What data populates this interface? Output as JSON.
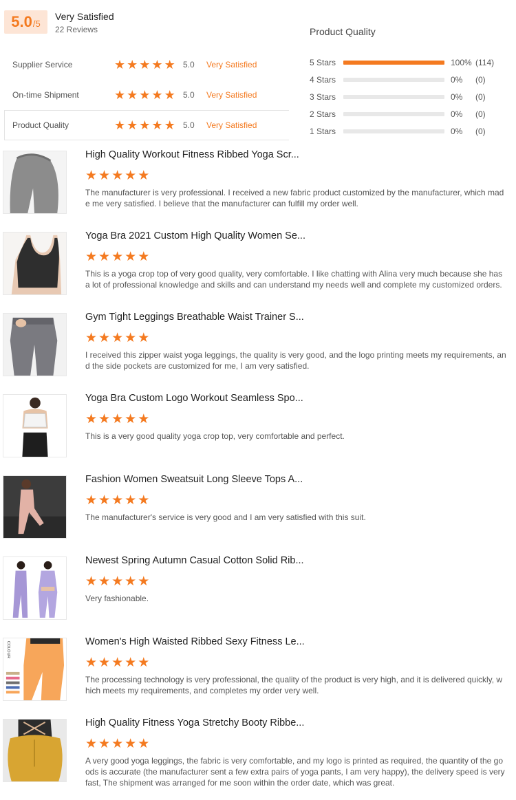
{
  "summary": {
    "score": "5.0",
    "score_max": "/5",
    "label": "Very Satisfied",
    "review_count": "22 Reviews",
    "star_glyph": "★",
    "accent_color": "#f47a20",
    "ratings": [
      {
        "label": "Supplier Service",
        "value": "5.0",
        "text": "Very Satisfied",
        "stars": 5
      },
      {
        "label": "On-time Shipment",
        "value": "5.0",
        "text": "Very Satisfied",
        "stars": 5
      },
      {
        "label": "Product Quality",
        "value": "5.0",
        "text": "Very Satisfied",
        "stars": 5
      }
    ]
  },
  "product_quality": {
    "title": "Product Quality",
    "rows": [
      {
        "label": "5 Stars",
        "percent": "100%",
        "count": "(114)",
        "fraction": 1.0
      },
      {
        "label": "4 Stars",
        "percent": "0%",
        "count": "(0)",
        "fraction": 0
      },
      {
        "label": "3 Stars",
        "percent": "0%",
        "count": "(0)",
        "fraction": 0
      },
      {
        "label": "2 Stars",
        "percent": "0%",
        "count": "(0)",
        "fraction": 0
      },
      {
        "label": "1 Stars",
        "percent": "0%",
        "count": "(0)",
        "fraction": 0
      }
    ]
  },
  "reviews": [
    {
      "title": "High Quality Workout Fitness Ribbed Yoga Scr...",
      "stars": 5,
      "text": "The manufacturer is very professional. I received a new fabric product customized by the manufacturer, which made me very satisfied. I believe that the manufacturer can fulfill my order well.",
      "thumb": "grey-leggings"
    },
    {
      "title": "Yoga Bra 2021 Custom High Quality Women Se...",
      "stars": 5,
      "text": "This is a yoga crop top of very good quality, very comfortable. I like chatting with Alina very much because she has a lot of professional knowledge and skills and can understand my needs well and complete my customized orders.",
      "thumb": "black-bra"
    },
    {
      "title": "Gym Tight Leggings Breathable Waist Trainer S...",
      "stars": 5,
      "text": "I received this zipper waist yoga leggings, the quality is very good, and the logo printing meets my requirements, and the side pockets are customized for me, I am very satisfied.",
      "thumb": "grey-waist-leggings"
    },
    {
      "title": "Yoga Bra Custom Logo Workout Seamless Spo...",
      "stars": 5,
      "text": "This is a very good quality yoga crop top, very comfortable and perfect.",
      "thumb": "white-bra"
    },
    {
      "title": "Fashion Women Sweatsuit Long Sleeve Tops A...",
      "stars": 5,
      "text": "The manufacturer's service is very good and I am very satisfied with this suit.",
      "thumb": "pink-sweatsuit"
    },
    {
      "title": "Newest Spring Autumn Casual Cotton Solid Rib...",
      "stars": 5,
      "text": "Very fashionable.",
      "thumb": "lilac-set"
    },
    {
      "title": "Women's High Waisted Ribbed Sexy Fitness Le...",
      "stars": 5,
      "text": "The processing technology is very professional, the quality of the product is very high, and it is delivered quickly, which meets my requirements, and completes my order very well.",
      "thumb": "orange-leggings",
      "thumb_text": "COLOUR"
    },
    {
      "title": "High Quality Fitness Yoga Stretchy Booty Ribbe...",
      "stars": 5,
      "text": "A very good yoga leggings, the fabric is very comfortable, and my logo is printed as required, the quantity of the goods is accurate (the manufacturer sent a few extra pairs of yoga pants, I am very happy), the delivery speed is very fast, The shipment was arranged for me soon within the order date, which was great.",
      "thumb": "mustard-leggings"
    }
  ]
}
